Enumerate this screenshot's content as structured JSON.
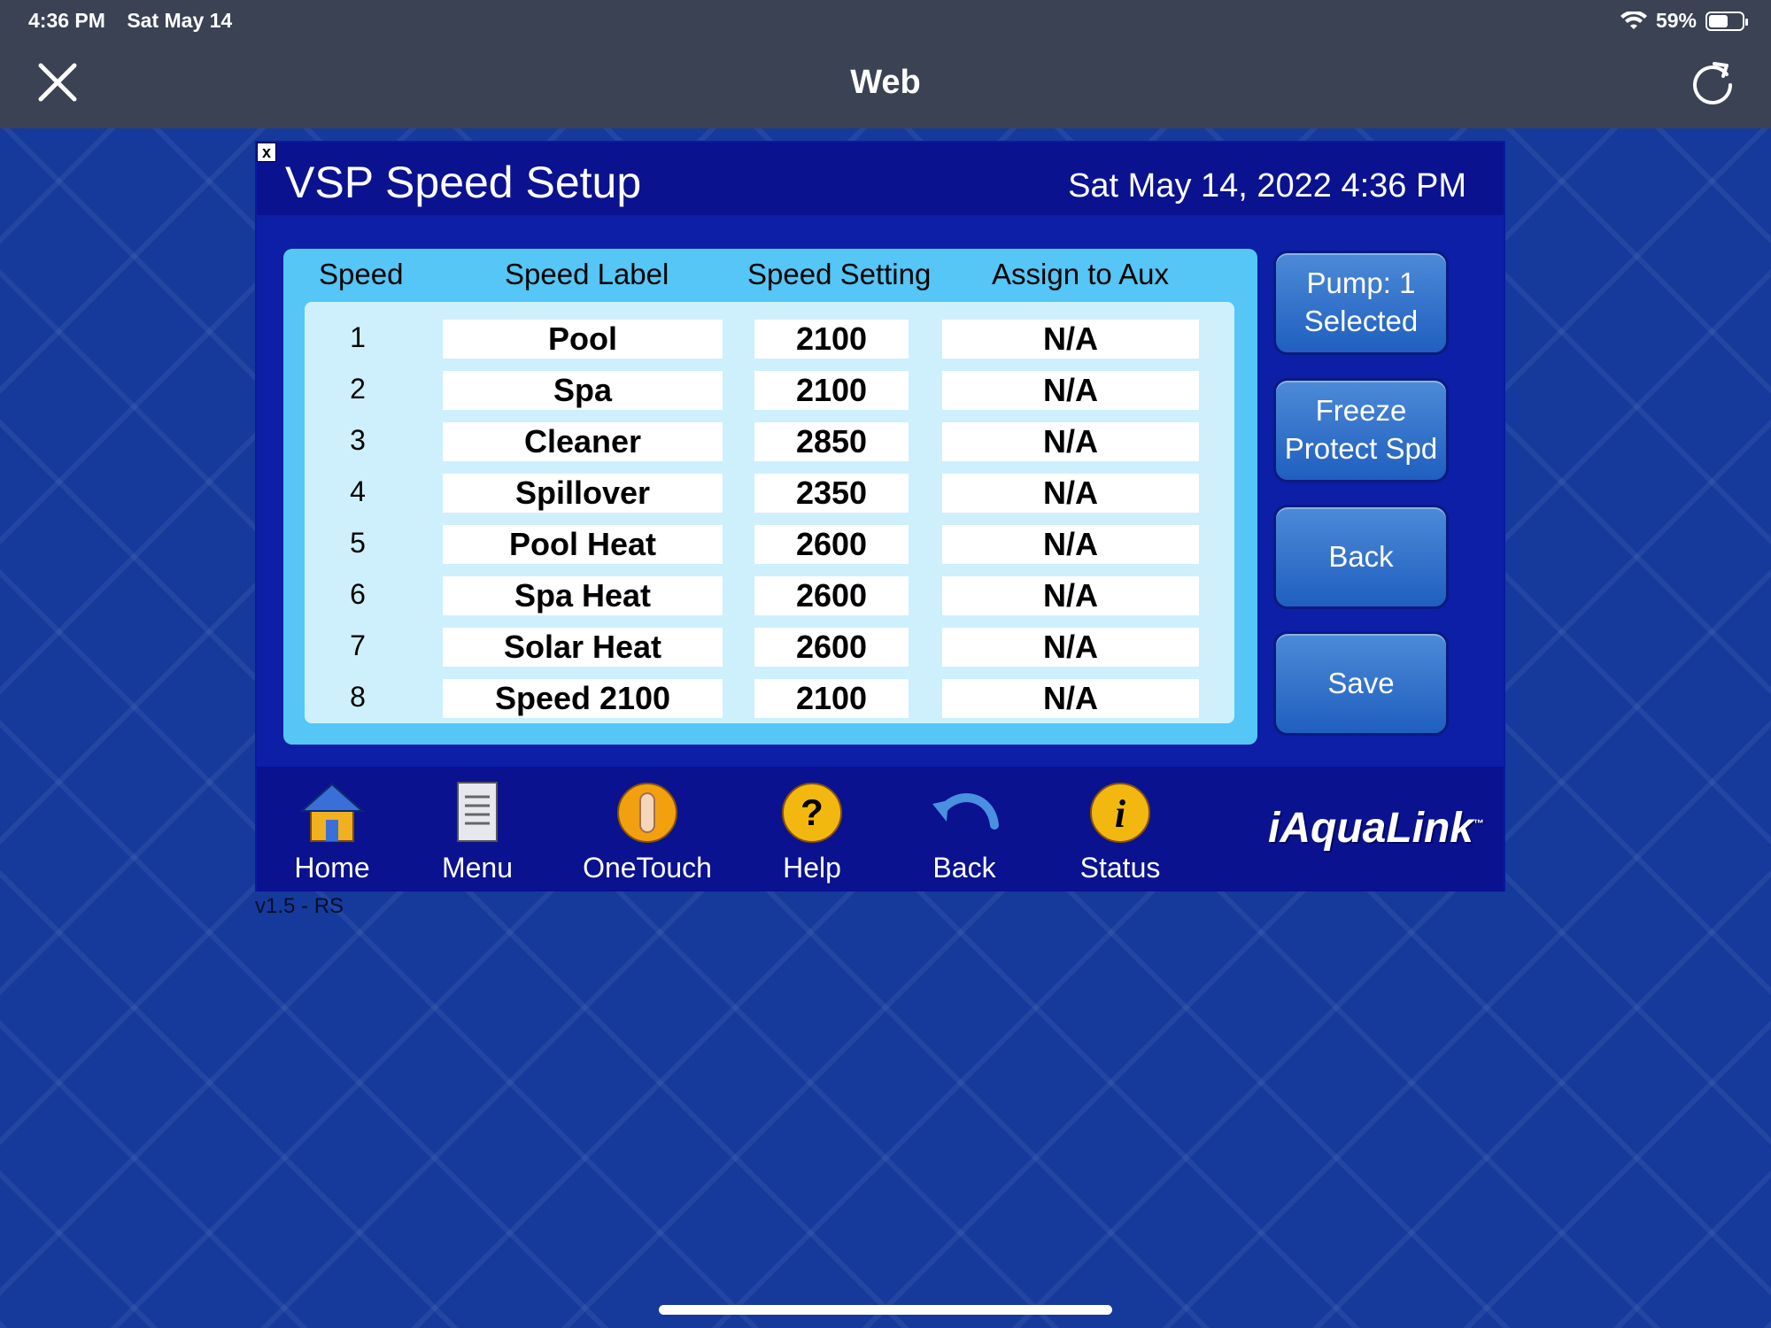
{
  "status_bar": {
    "time": "4:36 PM",
    "date": "Sat May 14",
    "battery": "59%",
    "battery_level": 0.59
  },
  "header": {
    "title": "Web",
    "close_icon": "close-icon",
    "reload_icon": "reload-icon"
  },
  "panel": {
    "close_glyph": "x",
    "title": "VSP Speed Setup",
    "datetime": "Sat May 14, 2022 4:36 PM"
  },
  "table": {
    "columns": [
      "Speed",
      "Speed Label",
      "Speed Setting",
      "Assign to Aux"
    ],
    "rows": [
      {
        "speed": "1",
        "label": "Pool",
        "setting": "2100",
        "aux": "N/A"
      },
      {
        "speed": "2",
        "label": "Spa",
        "setting": "2100",
        "aux": "N/A"
      },
      {
        "speed": "3",
        "label": "Cleaner",
        "setting": "2850",
        "aux": "N/A"
      },
      {
        "speed": "4",
        "label": "Spillover",
        "setting": "2350",
        "aux": "N/A"
      },
      {
        "speed": "5",
        "label": "Pool Heat",
        "setting": "2600",
        "aux": "N/A"
      },
      {
        "speed": "6",
        "label": "Spa Heat",
        "setting": "2600",
        "aux": "N/A"
      },
      {
        "speed": "7",
        "label": "Solar Heat",
        "setting": "2600",
        "aux": "N/A"
      },
      {
        "speed": "8",
        "label": "Speed 2100",
        "setting": "2100",
        "aux": "N/A"
      }
    ]
  },
  "side_buttons": {
    "pump_line1": "Pump: 1",
    "pump_line2": "Selected",
    "freeze_line1": "Freeze",
    "freeze_line2": "Protect Spd",
    "back": "Back",
    "save": "Save"
  },
  "nav": {
    "home": "Home",
    "menu": "Menu",
    "onetouch": "OneTouch",
    "help": "Help",
    "back": "Back",
    "status": "Status"
  },
  "brand": "iAquaLink",
  "brand_tm": "™",
  "version": "v1.5 - RS",
  "colors": {
    "background": "#153a9c",
    "panel": "#0d1fa6",
    "table_outer": "#55c6f5",
    "table_inner": "#cdf0fc",
    "button": "#1f5fbf",
    "topbar": "#3a4254"
  }
}
